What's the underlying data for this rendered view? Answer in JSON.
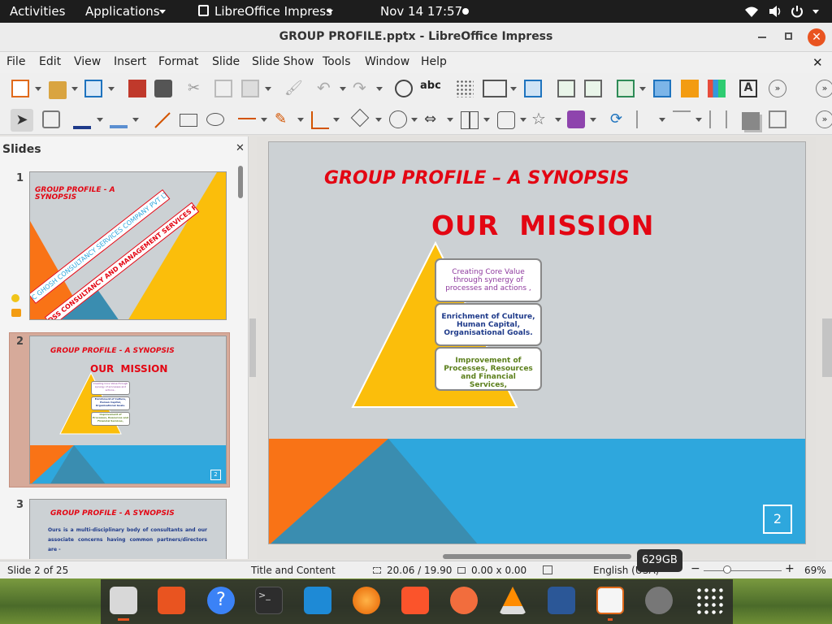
{
  "topbar": {
    "activities": "Activities",
    "applications": "Applications",
    "app_name": "LibreOffice Impress",
    "datetime": "Nov 14  17:57"
  },
  "window": {
    "title": "GROUP PROFILE.pptx - LibreOffice Impress"
  },
  "menu": [
    "File",
    "Edit",
    "View",
    "Insert",
    "Format",
    "Slide",
    "Slide Show",
    "Tools",
    "Window",
    "Help"
  ],
  "toolbar": {
    "spell_label": "abc"
  },
  "slides_panel": {
    "title": "Slides",
    "numbers": [
      "1",
      "2",
      "3"
    ]
  },
  "thumb1": {
    "title": "GROUP PROFILE - A SYNOPSIS",
    "banner1": "C GHOSH CONSULTANCY SERVICES COMPANY PVT LTD",
    "banner2": "DSS CONSULTANCY AND MANAGEMENT SERVICES PRIVATE LIMITED"
  },
  "thumb2": {
    "title": "GROUP PROFILE - A SYNOPSIS",
    "mission": "OUR  MISSION",
    "box1": "Creating Core Value through synergy of processes and actions ,",
    "box2": "Enrichment of Culture, Human Capital, Organisational Goals.",
    "box3": "Improvement of Processes, Resources and Financial Services,",
    "page": "2"
  },
  "thumb3": {
    "title": "GROUP PROFILE - A SYNOPSIS",
    "body": "Ours is a multi-disciplinary body of consultants and our associate concerns having common partners/directors are -"
  },
  "slide": {
    "title": "GROUP PROFILE – A SYNOPSIS",
    "mission": "OUR  MISSION",
    "box1": "Creating Core Value through synergy of processes and actions ,",
    "box2": "Enrichment of Culture, Human Capital, Organisational Goals.",
    "box3": "Improvement of Processes, Resources and Financial Services,",
    "page": "2"
  },
  "status": {
    "slide": "Slide 2 of 25",
    "layout": "Title and Content",
    "position": "20.06 / 19.90",
    "size": "0.00 x 0.00",
    "language": "English (USA)",
    "zoom": "69%"
  },
  "tooltip": "629GB",
  "colors": {
    "title_red": "#e30613",
    "triangle_yellow": "#fbbe0b",
    "orange": "#f97316",
    "sky_blue": "#2ea7dd",
    "teal": "#3a8db0",
    "slide_gray": "#ccd1d4"
  }
}
